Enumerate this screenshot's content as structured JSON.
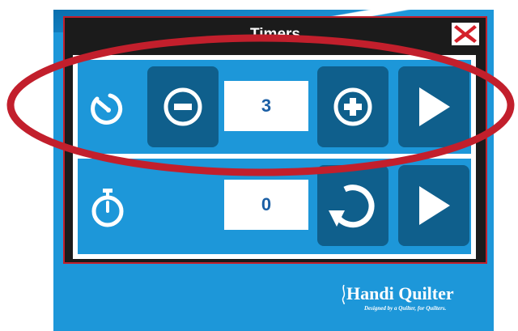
{
  "dialog": {
    "title": "Timers",
    "close_icon": "close-x-icon"
  },
  "countdown_timer": {
    "icon": "countdown-timer-icon",
    "decrement_icon": "minus-circle-icon",
    "value": "3",
    "increment_icon": "plus-circle-icon",
    "start_icon": "play-icon"
  },
  "stopwatch": {
    "icon": "stopwatch-icon",
    "value": "0",
    "reset_icon": "reset-icon",
    "start_icon": "play-icon"
  },
  "branding": {
    "name": "Handi Quilter",
    "tagline": "Designed by a Quilter, for Quilters."
  },
  "colors": {
    "screen_background": "#1d97d9",
    "dialog_frame": "#1b1b1b",
    "button_tile": "#0f5f8c",
    "annotation": "#c21f2c",
    "value_text": "#1b5fa5"
  }
}
